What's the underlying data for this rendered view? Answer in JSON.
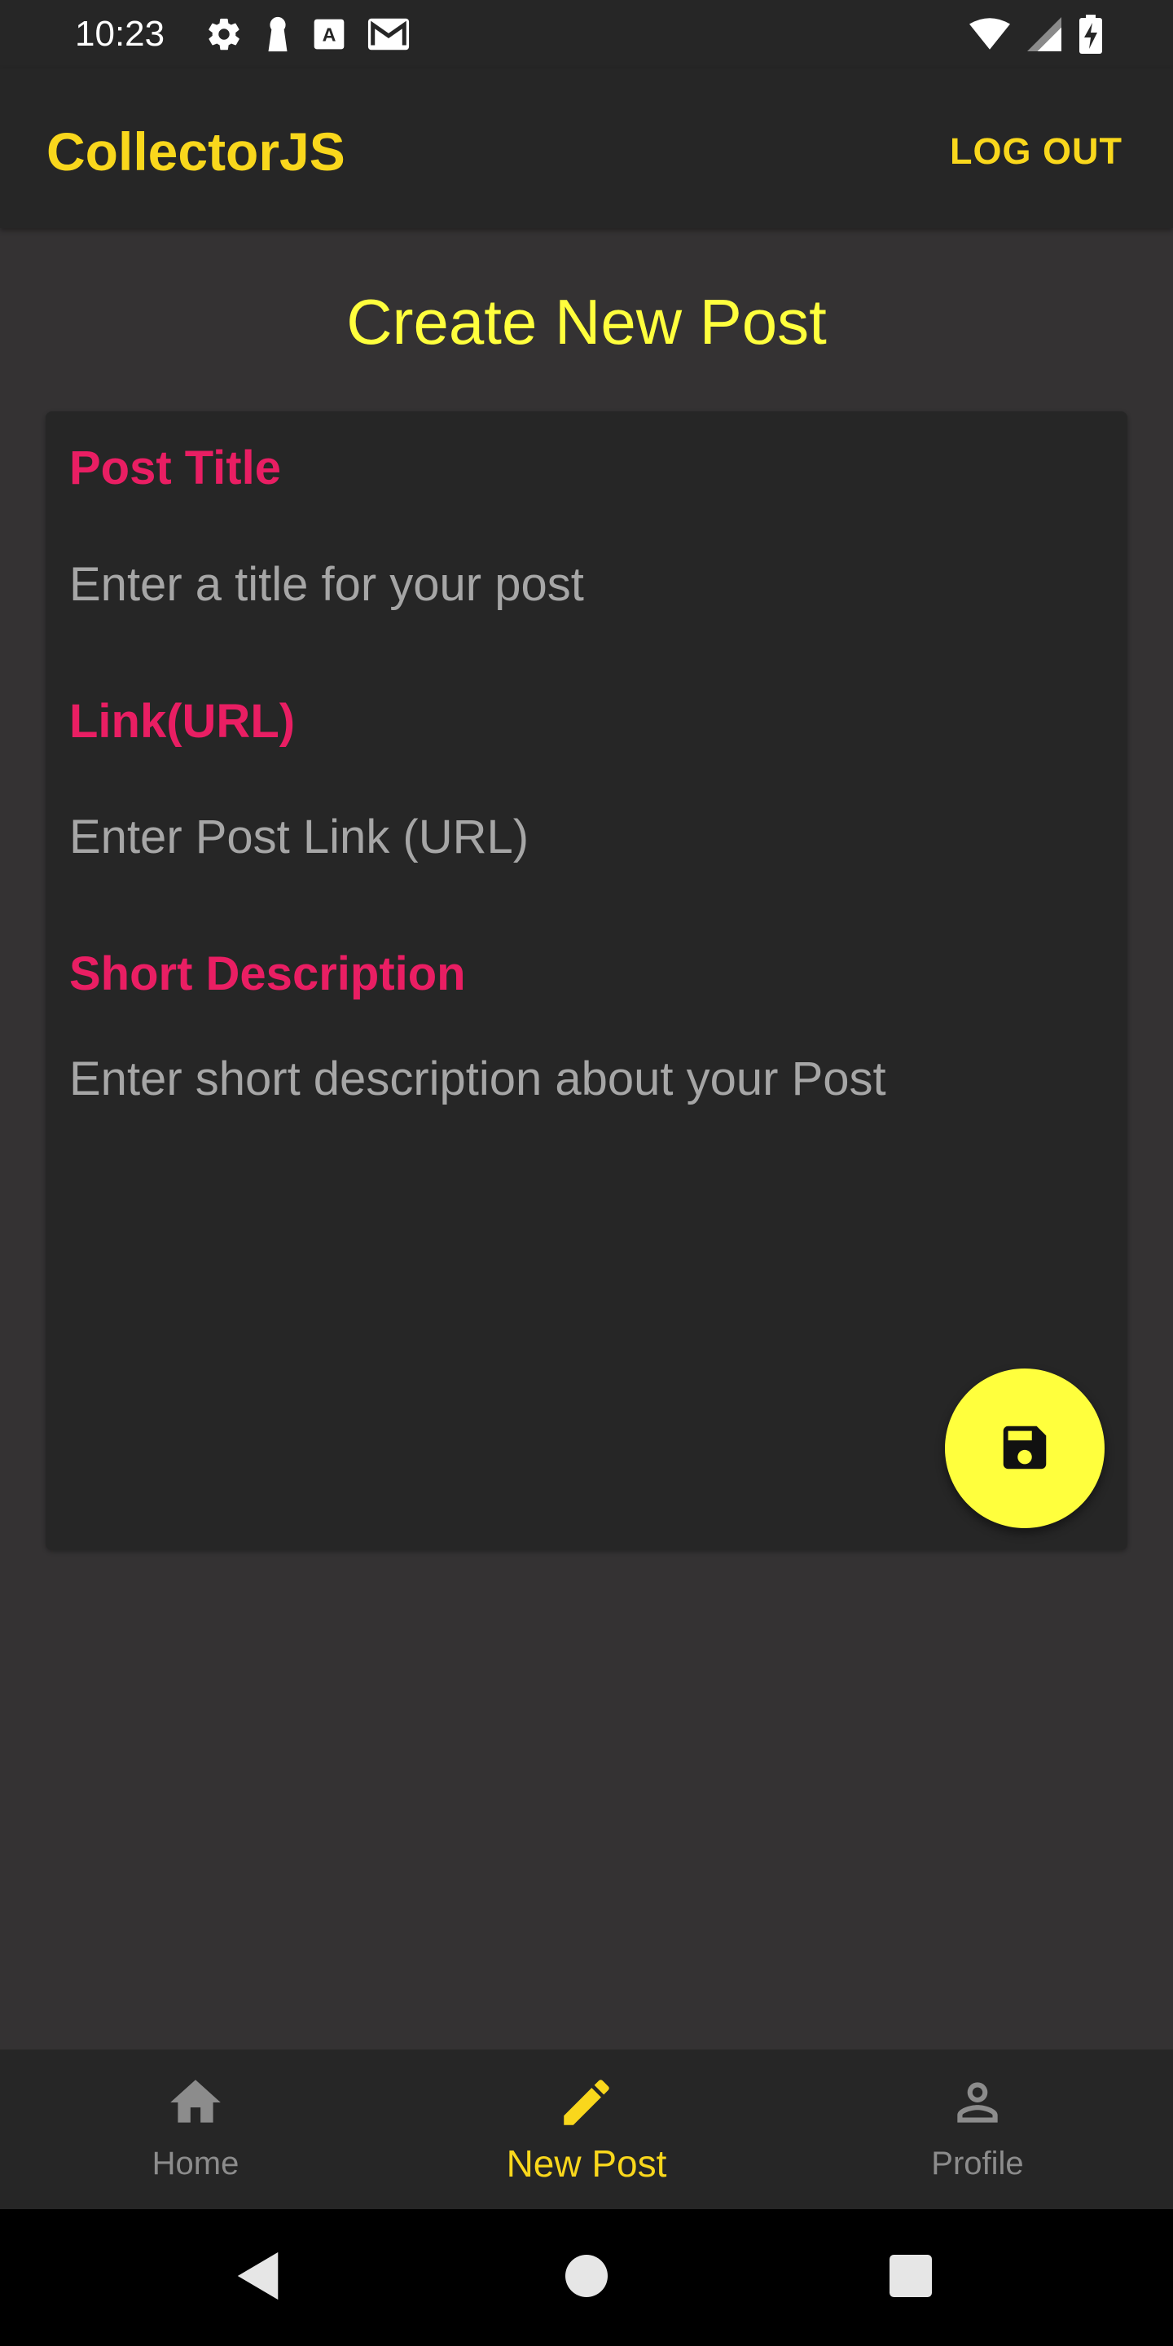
{
  "status_bar": {
    "time": "10:23",
    "left_icons": [
      "gear-icon",
      "keyhole-icon",
      "font-a-icon",
      "gmail-icon"
    ],
    "right_icons": [
      "wifi-icon",
      "cell-signal-icon",
      "battery-charging-icon"
    ]
  },
  "app_bar": {
    "title": "CollectorJS",
    "logout_label": "LOG OUT"
  },
  "page": {
    "title": "Create New Post"
  },
  "form": {
    "title_label": "Post Title",
    "title_placeholder": "Enter a title for your post",
    "title_value": "",
    "link_label": "Link(URL)",
    "link_placeholder": "Enter Post Link (URL)",
    "link_value": "",
    "description_label": "Short Description",
    "description_placeholder": "Enter short description about your Post",
    "description_value": "",
    "save_icon": "floppy-disk-icon"
  },
  "bottom_nav": {
    "items": [
      {
        "label": "Home",
        "icon": "home-icon",
        "active": false
      },
      {
        "label": "New Post",
        "icon": "pencil-icon",
        "active": true
      },
      {
        "label": "Profile",
        "icon": "person-icon",
        "active": false
      }
    ]
  },
  "system_nav": {
    "buttons": [
      "back-triangle-icon",
      "home-circle-icon",
      "recents-square-icon"
    ]
  },
  "colors": {
    "accent_yellow": "#f9d71c",
    "heading_yellow": "#ffff3d",
    "label_pink": "#e91e63",
    "surface": "#262626",
    "background": "#343233",
    "inactive_gray": "#8c8c8c"
  }
}
